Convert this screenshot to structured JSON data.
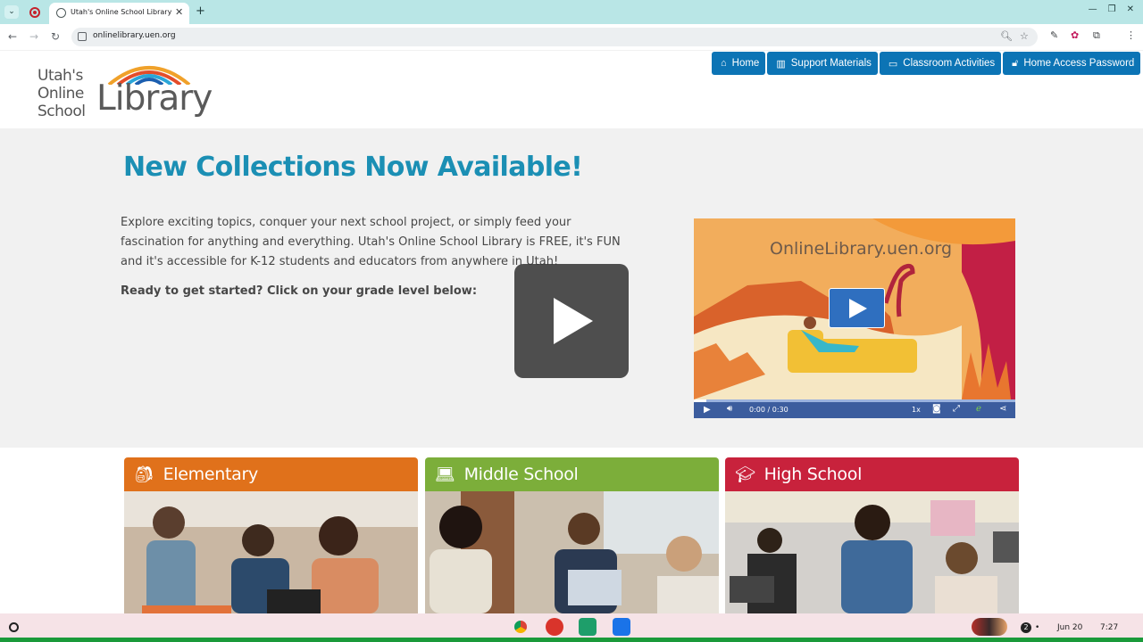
{
  "browser": {
    "tab_title": "Utah's Online School Library",
    "new_tab_symbol": "+",
    "url": "onlinelibrary.uen.org"
  },
  "logo": {
    "line1": "Utah's",
    "line2": "Online",
    "line3": "School",
    "big": "Library"
  },
  "nav": {
    "items": [
      {
        "label": "Home",
        "icon": "home-icon"
      },
      {
        "label": "Support Materials",
        "icon": "books-icon"
      },
      {
        "label": "Classroom Activities",
        "icon": "classroom-icon"
      },
      {
        "label": "Home Access Password",
        "icon": "unlock-icon"
      }
    ]
  },
  "hero": {
    "heading": "New Collections Now Available!",
    "description": "Explore exciting topics, conquer your next school project, or simply feed your fascination for anything and everything. Utah's Online School Library is FREE, it's FUN and it's accessible for K-12 students and educators from anywhere in Utah!",
    "cta": "Ready to get started? Click on your grade level below:"
  },
  "video": {
    "title_text": "OnlineLibrary.uen.org",
    "time": "0:00 / 0:30",
    "speed": "1x",
    "progress_fraction": 0.04
  },
  "grades": [
    {
      "label": "Elementary",
      "icon": "backpack-icon",
      "color": "#e0711b"
    },
    {
      "label": "Middle School",
      "icon": "laptop-icon",
      "color": "#7cae3a"
    },
    {
      "label": "High School",
      "icon": "graduation-cap-icon",
      "color": "#c8223c"
    }
  ],
  "shelf": {
    "date": "Jun 20",
    "time": "7:27",
    "notification_count": "2"
  },
  "colors": {
    "nav_blue": "#0c74b5",
    "heading_blue": "#1b8fb4",
    "tabstrip": "#b9e6e6"
  }
}
